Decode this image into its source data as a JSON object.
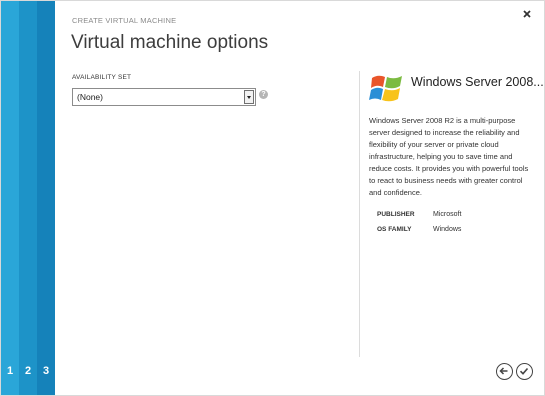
{
  "wizard": {
    "steps": [
      "1",
      "2",
      "3"
    ],
    "subtitle": "CREATE VIRTUAL MACHINE",
    "title": "Virtual machine options"
  },
  "availability_set": {
    "label": "AVAILABILITY SET",
    "selected": "(None)",
    "help": "?"
  },
  "image_info": {
    "title": "Windows Server 2008...",
    "description": "Windows Server 2008 R2 is a multi-purpose server designed to increase the reliability and flexibility of your server or private cloud infrastructure, helping you to save time and reduce costs. It provides you with powerful tools to react to business needs with greater control and confidence.",
    "details": [
      {
        "key": "PUBLISHER",
        "value": "Microsoft"
      },
      {
        "key": "OS FAMILY",
        "value": "Windows"
      }
    ]
  },
  "icons": {
    "close": "close-icon",
    "back": "back-arrow-icon",
    "complete": "checkmark-icon",
    "logo": "windows-logo-icon"
  },
  "colors": {
    "step1": "#2aa6d8",
    "step2": "#1d93c8",
    "step3": "#1582ba"
  }
}
